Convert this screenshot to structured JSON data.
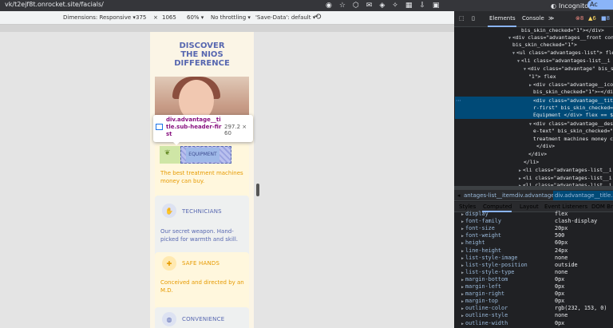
{
  "browser": {
    "url": "vk/t2ejf8t.onrocket.site/facials/",
    "profile": "Incognito",
    "action_label": "Ac"
  },
  "device_toolbar": {
    "dimensions_label": "Dimensions: Responsive ▾",
    "width": "375",
    "times": "×",
    "height": "1065",
    "zoom": "60% ▾",
    "throttle": "No throttling ▾",
    "save_data": "'Save-Data': default ▾"
  },
  "page": {
    "headline": [
      "DISCOVER",
      "THE NIOS",
      "DIFFERENCE"
    ],
    "cards": [
      {
        "title": "EQUIPMENT",
        "text": "The best treatment machines money can buy.",
        "icon": "leaf-icon"
      },
      {
        "title": "TECHNICIANS",
        "text": "Our secret weapon. Hand-picked for warmth and skill.",
        "icon": "hands-icon"
      },
      {
        "title": "SAFE HANDS",
        "text": "Conceived and directed by an M.D.",
        "icon": "medical-icon"
      },
      {
        "title": "CONVENIENCE",
        "text": "",
        "icon": "globe-icon"
      }
    ]
  },
  "tooltip": {
    "name": "div.advantage__title.sub-header-first",
    "size": "297.2 × 60"
  },
  "devtools": {
    "tabs": [
      "Elements",
      "Console",
      "≫"
    ],
    "errors": "8",
    "warnings": "6",
    "info": "8",
    "dom_lines": [
      "bis_skin_checked=\"1\"></div>",
      "<div class=\"advantages__front con",
      "bis_skin_checked=\"1\">",
      "<ul class=\"advantages-list\"> flex",
      "<li class=\"advantages-list__i",
      "<div class=\"advantage\" bis_s",
      "\"1\"> flex",
      "<div class=\"advantage__ico",
      "bis_skin_checked=\"1\">⋯</div>",
      "<div class=\"advantage__tit",
      "r-first\" bis_skin_checked=",
      "Equipment </div> flex == $",
      "<div class=\"advantage__desc",
      "e-text\" bis_skin_checked=\"",
      "treatment machines money ca",
      "</div>",
      "</div>",
      "</li>",
      "<li class=\"advantages-list__i",
      "<li class=\"advantages-list__i",
      "<li class=\"advantages-list__i"
    ],
    "breadcrumbs": [
      "antages-list__item",
      "div.advantage",
      "div.advantage__title.sub"
    ],
    "style_tabs": [
      "Styles",
      "Computed",
      "Layout",
      "Event Listeners",
      "DOM Br"
    ],
    "computed": [
      {
        "prop": "display",
        "val": "flex"
      },
      {
        "prop": "font-family",
        "val": "clash-display"
      },
      {
        "prop": "font-size",
        "val": "20px"
      },
      {
        "prop": "font-weight",
        "val": "500"
      },
      {
        "prop": "height",
        "val": "60px"
      },
      {
        "prop": "line-height",
        "val": "24px"
      },
      {
        "prop": "list-style-image",
        "val": "none"
      },
      {
        "prop": "list-style-position",
        "val": "outside"
      },
      {
        "prop": "list-style-type",
        "val": "none"
      },
      {
        "prop": "margin-bottom",
        "val": "0px"
      },
      {
        "prop": "margin-left",
        "val": "0px"
      },
      {
        "prop": "margin-right",
        "val": "0px"
      },
      {
        "prop": "margin-top",
        "val": "0px"
      },
      {
        "prop": "outline-color",
        "val": "rgb(232, 153, 0)"
      },
      {
        "prop": "outline-style",
        "val": "none"
      },
      {
        "prop": "outline-width",
        "val": "0px"
      }
    ]
  },
  "colors": {
    "brand_blue": "#5767b0",
    "brand_orange": "#e69a00",
    "card_bg": "#fff7dd"
  }
}
